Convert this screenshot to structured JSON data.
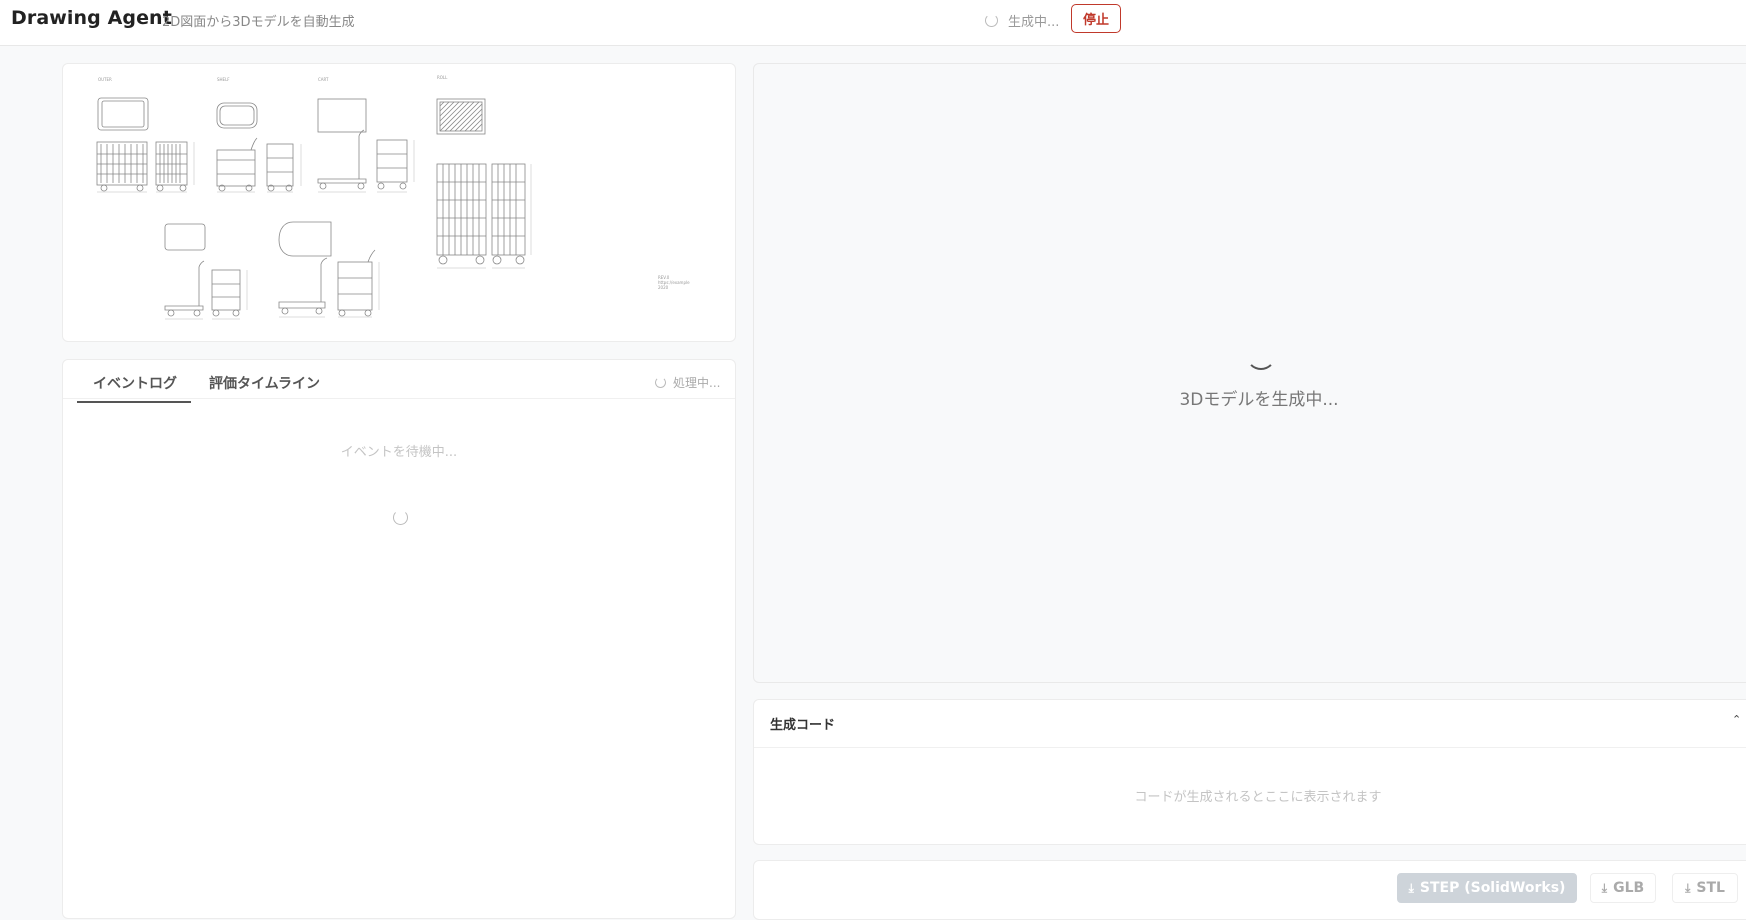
{
  "header": {
    "title": "Drawing Agent",
    "subtitle": "2D図面から3Dモデルを自動生成",
    "status_text": "生成中...",
    "stop_label": "停止"
  },
  "drawing_panel": {
    "view_labels": [
      "OUTER",
      "SHELF",
      "CART",
      "ROLL"
    ],
    "note_lines": [
      "REV.0",
      "https://example",
      "2020"
    ]
  },
  "log_panel": {
    "tabs": [
      {
        "label": "イベントログ",
        "active": true
      },
      {
        "label": "評価タイムライン",
        "active": false
      }
    ],
    "status_text": "処理中...",
    "empty_text": "イベントを待機中..."
  },
  "viewer": {
    "status_text": "3Dモデルを生成中..."
  },
  "code_panel": {
    "title": "生成コード",
    "chevron": "⌃",
    "empty_text": "コードが生成されるとここに表示されます"
  },
  "downloads": {
    "icon": "download-icon",
    "step_label": "STEP (SolidWorks)",
    "glb_label": "GLB",
    "stl_label": "STL"
  }
}
